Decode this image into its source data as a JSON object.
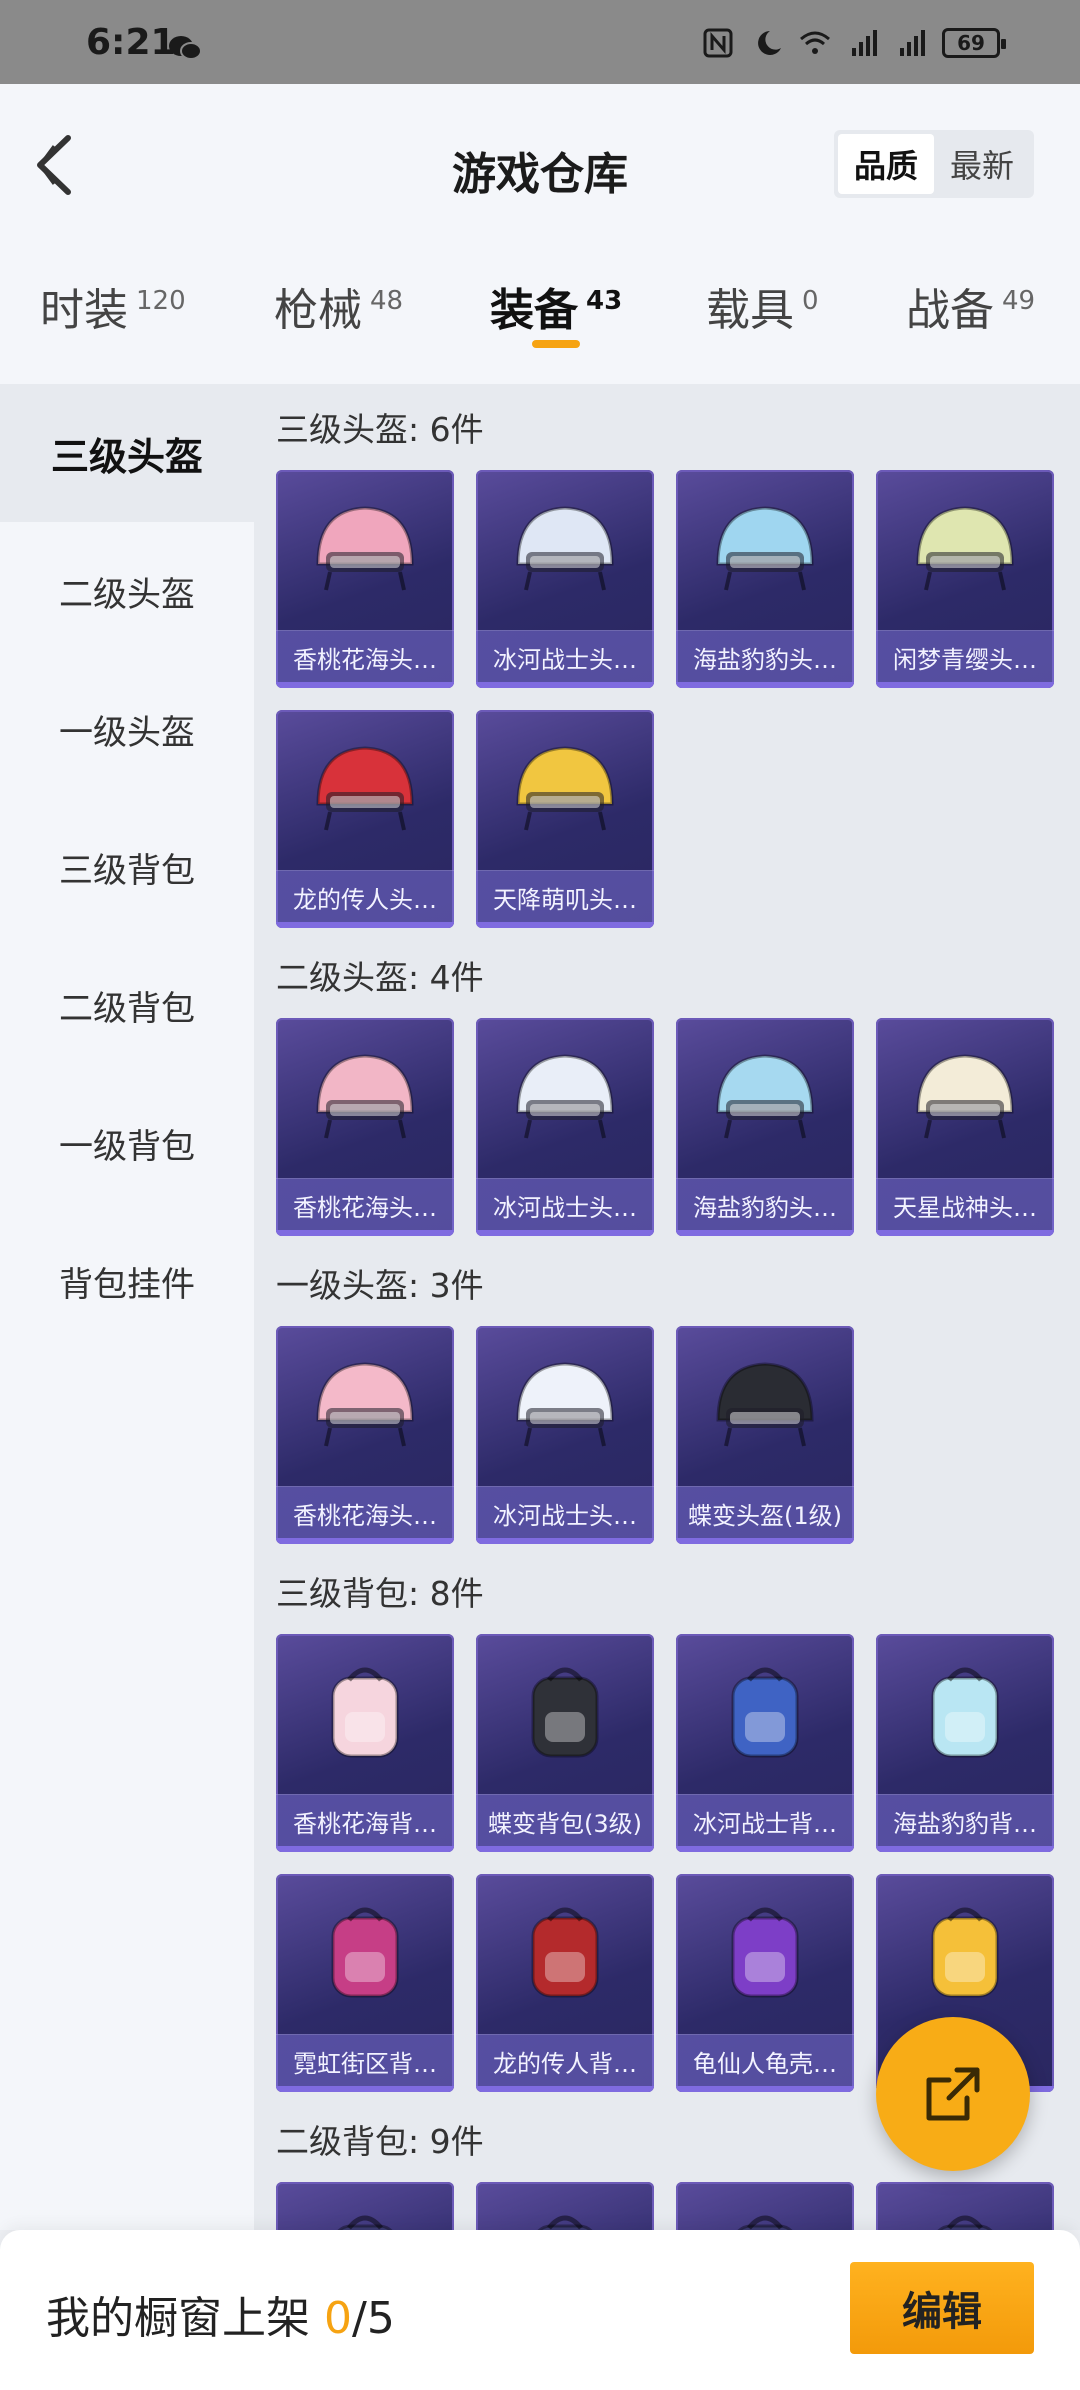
{
  "status_bar": {
    "time": "6:21",
    "battery": "69"
  },
  "header": {
    "title": "游戏仓库",
    "sort_options": [
      "品质",
      "最新"
    ]
  },
  "tabs": [
    {
      "label": "时装",
      "count": "120"
    },
    {
      "label": "枪械",
      "count": "48"
    },
    {
      "label": "装备",
      "count": "43"
    },
    {
      "label": "载具",
      "count": "0"
    },
    {
      "label": "战备",
      "count": "49"
    }
  ],
  "sidebar": {
    "items": [
      "三级头盔",
      "二级头盔",
      "一级头盔",
      "三级背包",
      "二级背包",
      "一级背包",
      "背包挂件"
    ]
  },
  "sections": [
    {
      "title": "三级头盔: 6件",
      "items": [
        {
          "name": "香桃花海头…",
          "color": "#f0a6bd"
        },
        {
          "name": "冰河战士头…",
          "color": "#dfe7f5"
        },
        {
          "name": "海盐豹豹头…",
          "color": "#9fd6f0"
        },
        {
          "name": "闲梦青缨头…",
          "color": "#dfe6b0"
        },
        {
          "name": "龙的传人头…",
          "color": "#d8323a"
        },
        {
          "name": "天降萌叽头…",
          "color": "#f1c640"
        }
      ]
    },
    {
      "title": "二级头盔: 4件",
      "items": [
        {
          "name": "香桃花海头…",
          "color": "#f2b6c6"
        },
        {
          "name": "冰河战士头…",
          "color": "#e9eef8"
        },
        {
          "name": "海盐豹豹头…",
          "color": "#a6d9f0"
        },
        {
          "name": "天星战神头…",
          "color": "#f3ecd8"
        }
      ]
    },
    {
      "title": "一级头盔: 3件",
      "items": [
        {
          "name": "香桃花海头…",
          "color": "#f4b9c9"
        },
        {
          "name": "冰河战士头…",
          "color": "#eef2fa"
        },
        {
          "name": "蝶变头盔(1级)",
          "color": "#2a2c33"
        }
      ]
    },
    {
      "title": "三级背包: 8件",
      "items": [
        {
          "name": "香桃花海背…",
          "color": "#f6d5de"
        },
        {
          "name": "蝶变背包(3级)",
          "color": "#2f3138"
        },
        {
          "name": "冰河战士背…",
          "color": "#3f63c4"
        },
        {
          "name": "海盐豹豹背…",
          "color": "#b9e6f3"
        },
        {
          "name": "霓虹街区背…",
          "color": "#c63e86"
        },
        {
          "name": "龙的传人背…",
          "color": "#b42a2c"
        },
        {
          "name": "龟仙人龟壳…",
          "color": "#7d3ec7"
        },
        {
          "name": "",
          "color": "#f5c039"
        }
      ]
    },
    {
      "title": "二级背包: 9件",
      "items": [
        {
          "name": "",
          "color": "#3b3a70"
        },
        {
          "name": "",
          "color": "#3b3a70"
        },
        {
          "name": "",
          "color": "#3b3a70"
        },
        {
          "name": "",
          "color": "#3b3a70"
        }
      ]
    }
  ],
  "bottom_bar": {
    "label": "我的橱窗上架",
    "shelved": "0",
    "total": "/5",
    "edit_label": "编辑"
  }
}
